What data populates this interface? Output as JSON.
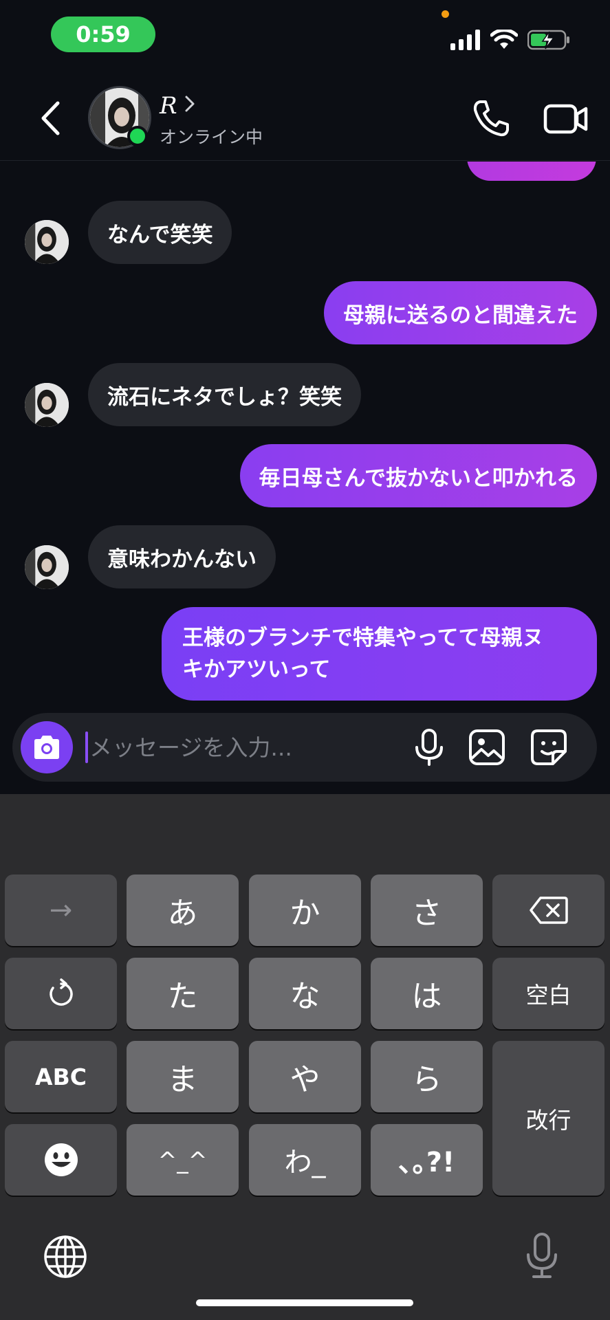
{
  "status_bar": {
    "time": "0:59"
  },
  "header": {
    "back_icon": "chevron-left-icon",
    "contact_name": "R",
    "contact_status": "オンライン中",
    "call_icon": "phone-icon",
    "video_icon": "video-camera-icon"
  },
  "messages": [
    {
      "direction": "in",
      "text": "なんで笑笑"
    },
    {
      "direction": "out",
      "text": "母親に送るのと間違えた"
    },
    {
      "direction": "in",
      "text": "流石にネタでしょ？笑笑"
    },
    {
      "direction": "out",
      "text": "毎日母さんで抜かないと叩かれる"
    },
    {
      "direction": "in",
      "text": "意味わかんない"
    },
    {
      "direction": "out",
      "lines": [
        "王様のブランチで特集やってて母親ヌ",
        "キかアツいって"
      ]
    }
  ],
  "composer": {
    "placeholder": "メッセージを入力...",
    "camera_icon": "camera-icon",
    "mic_icon": "microphone-icon",
    "image_icon": "image-icon",
    "sticker_icon": "sticker-icon"
  },
  "keyboard": {
    "row1": [
      "→",
      "あ",
      "か",
      "さ",
      "delete"
    ],
    "row2": [
      "undo",
      "た",
      "な",
      "は",
      "空白"
    ],
    "row3": [
      "ABC",
      "ま",
      "や",
      "ら",
      "改行"
    ],
    "row4": [
      "emoji",
      "^_^",
      "わ_",
      "､｡?!"
    ],
    "labels": {
      "arrow": "→",
      "a": "あ",
      "ka": "か",
      "sa": "さ",
      "ta": "た",
      "na": "な",
      "ha": "は",
      "space": "空白",
      "abc": "ABC",
      "ma": "ま",
      "ya": "や",
      "ra": "ら",
      "enter": "改行",
      "kaomoji": "^_^",
      "wa": "わ_",
      "punct": "､｡?!"
    },
    "globe_icon": "globe-icon",
    "dictation_icon": "microphone-icon"
  },
  "colors": {
    "background": "#0c0e14",
    "incoming_bubble": "#25272d",
    "outgoing_bubble": "#8a3ef0",
    "accent": "#7b40f2",
    "online": "#1fd655",
    "time_pill": "#34c759"
  }
}
